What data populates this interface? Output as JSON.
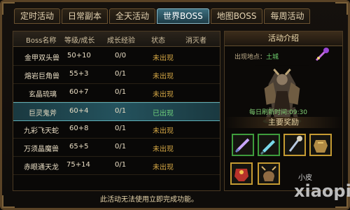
{
  "tabs": [
    {
      "label": "定时活动"
    },
    {
      "label": "日常副本"
    },
    {
      "label": "全天活动"
    },
    {
      "label": "世界BOSS"
    },
    {
      "label": "地图BOSS"
    },
    {
      "label": "每周活动"
    }
  ],
  "table": {
    "headers": [
      "Boss名称",
      "等级/成长",
      "成长经验",
      "状态",
      "消灭者"
    ],
    "rows": [
      {
        "name": "金甲双头兽",
        "level": "50+10",
        "exp": "0/0",
        "status": "未出现",
        "killer": ""
      },
      {
        "name": "熔岩巨角兽",
        "level": "55+3",
        "exp": "0/1",
        "status": "未出现",
        "killer": ""
      },
      {
        "name": "玄晶琉璃",
        "level": "60+7",
        "exp": "0/1",
        "status": "未出现",
        "killer": ""
      },
      {
        "name": "巨灵鬼斧",
        "level": "60+4",
        "exp": "0/1",
        "status": "已出现",
        "killer": ""
      },
      {
        "name": "九彩飞天蛇",
        "level": "60+8",
        "exp": "0/1",
        "status": "未出现",
        "killer": ""
      },
      {
        "name": "万须晶魔兽",
        "level": "65+5",
        "exp": "0/1",
        "status": "未出现",
        "killer": ""
      },
      {
        "name": "赤眼通天龙",
        "level": "75+14",
        "exp": "0/1",
        "status": "未出现",
        "killer": ""
      }
    ]
  },
  "activity": {
    "title": "活动介绍",
    "location_label": "出现地点：",
    "location": "土城",
    "refresh": "每日刷新时间:09:30",
    "reward_title": "主要奖励"
  },
  "notice": "此活动无法使用立即完成功能。",
  "watermark": {
    "small": "小皮",
    "big": "xiaopi"
  }
}
